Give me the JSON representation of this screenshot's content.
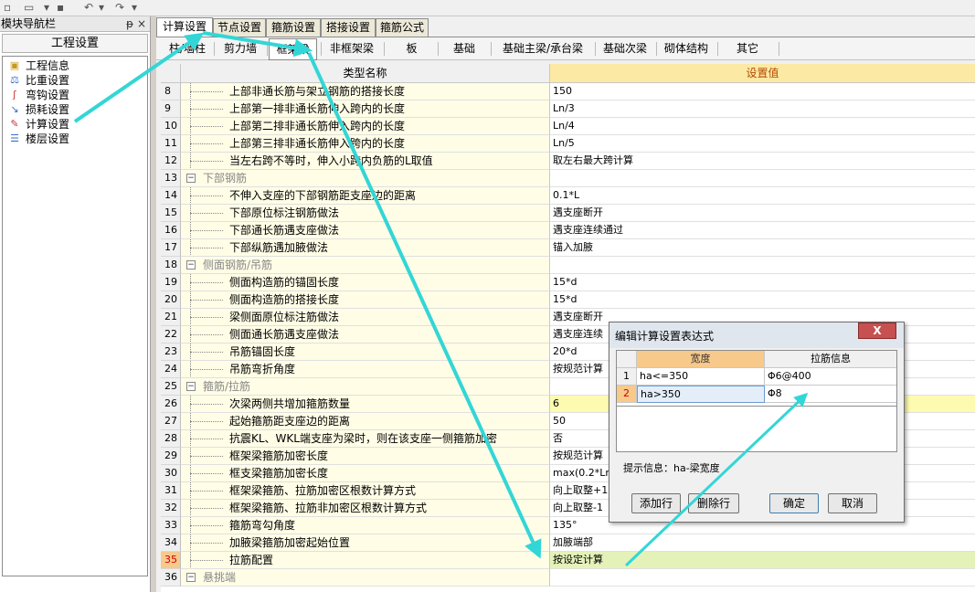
{
  "toolbar": {
    "icons": [
      "new-file-icon",
      "open-folder-icon",
      "save-icon",
      "undo-icon",
      "redo-icon"
    ]
  },
  "nav": {
    "header": "模块导航栏",
    "pin_glyph": "ᵽ",
    "close_glyph": "×",
    "title": "工程设置",
    "items": [
      {
        "label": "工程信息",
        "icon": "project-info-icon"
      },
      {
        "label": "比重设置",
        "icon": "ratio-icon"
      },
      {
        "label": "弯钩设置",
        "icon": "hook-icon"
      },
      {
        "label": "损耗设置",
        "icon": "loss-icon"
      },
      {
        "label": "计算设置",
        "icon": "calc-icon"
      },
      {
        "label": "楼层设置",
        "icon": "floor-icon"
      }
    ]
  },
  "tabs": [
    "计算设置",
    "节点设置",
    "箍筋设置",
    "搭接设置",
    "箍筋公式"
  ],
  "subtabs": [
    "柱/墙柱",
    "剪力墙",
    "框架梁",
    "非框架梁",
    "板",
    "基础",
    "基础主梁/承台梁",
    "基础次梁",
    "砌体结构",
    "其它"
  ],
  "grid": {
    "col_name": "类型名称",
    "col_value": "设置值",
    "rows": [
      {
        "n": "8",
        "type": "item",
        "name": "上部非通长筋与架立钢筋的搭接长度",
        "value": "150"
      },
      {
        "n": "9",
        "type": "item",
        "name": "上部第一排非通长筋伸入跨内的长度",
        "value": "Ln/3"
      },
      {
        "n": "10",
        "type": "item",
        "name": "上部第二排非通长筋伸入跨内的长度",
        "value": "Ln/4"
      },
      {
        "n": "11",
        "type": "item",
        "name": "上部第三排非通长筋伸入跨内的长度",
        "value": "Ln/5"
      },
      {
        "n": "12",
        "type": "item",
        "name": "当左右跨不等时，伸入小跨内负筋的L取值",
        "value": "取左右最大跨计算"
      },
      {
        "n": "13",
        "type": "cat",
        "name": "下部钢筋",
        "value": ""
      },
      {
        "n": "14",
        "type": "item",
        "name": "不伸入支座的下部钢筋距支座边的距离",
        "value": "0.1*L"
      },
      {
        "n": "15",
        "type": "item",
        "name": "下部原位标注钢筋做法",
        "value": "遇支座断开"
      },
      {
        "n": "16",
        "type": "item",
        "name": "下部通长筋遇支座做法",
        "value": "遇支座连续通过"
      },
      {
        "n": "17",
        "type": "item",
        "name": "下部纵筋遇加腋做法",
        "value": "锚入加腋"
      },
      {
        "n": "18",
        "type": "cat",
        "name": "侧面钢筋/吊筋",
        "value": ""
      },
      {
        "n": "19",
        "type": "item",
        "name": "侧面构造筋的锚固长度",
        "value": "15*d"
      },
      {
        "n": "20",
        "type": "item",
        "name": "侧面构造筋的搭接长度",
        "value": "15*d"
      },
      {
        "n": "21",
        "type": "item",
        "name": "梁侧面原位标注筋做法",
        "value": "遇支座断开"
      },
      {
        "n": "22",
        "type": "item",
        "name": "侧面通长筋遇支座做法",
        "value": "遇支座连续"
      },
      {
        "n": "23",
        "type": "item",
        "name": "吊筋锚固长度",
        "value": "20*d"
      },
      {
        "n": "24",
        "type": "item",
        "name": "吊筋弯折角度",
        "value": "按规范计算"
      },
      {
        "n": "25",
        "type": "cat",
        "name": "箍筋/拉筋",
        "value": ""
      },
      {
        "n": "26",
        "type": "item",
        "name": "次梁两侧共增加箍筋数量",
        "value": "6",
        "hl": true
      },
      {
        "n": "27",
        "type": "item",
        "name": "起始箍筋距支座边的距离",
        "value": "50"
      },
      {
        "n": "28",
        "type": "item",
        "name": "抗震KL、WKL端支座为梁时，则在该支座一侧箍筋加密",
        "value": "否"
      },
      {
        "n": "29",
        "type": "item",
        "name": "框架梁箍筋加密长度",
        "value": "按规范计算"
      },
      {
        "n": "30",
        "type": "item",
        "name": "框支梁箍筋加密长度",
        "value": "max(0.2*Ln"
      },
      {
        "n": "31",
        "type": "item",
        "name": "框架梁箍筋、拉筋加密区根数计算方式",
        "value": "向上取整+1"
      },
      {
        "n": "32",
        "type": "item",
        "name": "框架梁箍筋、拉筋非加密区根数计算方式",
        "value": "向上取整-1"
      },
      {
        "n": "33",
        "type": "item",
        "name": "箍筋弯勾角度",
        "value": "135°"
      },
      {
        "n": "34",
        "type": "item",
        "name": "加腋梁箍筋加密起始位置",
        "value": "加腋端部"
      },
      {
        "n": "35",
        "type": "item",
        "name": "拉筋配置",
        "value": "按设定计算",
        "sel": true
      },
      {
        "n": "36",
        "type": "cat",
        "name": "悬挑端",
        "value": ""
      }
    ]
  },
  "dialog": {
    "title": "编辑计算设置表达式",
    "close_glyph": "X",
    "col_width": "宽度",
    "col_info": "拉筋信息",
    "rows": [
      {
        "n": "1",
        "width": "ha<=350",
        "info": "Φ6@400"
      },
      {
        "n": "2",
        "width": "ha>350",
        "info": "Φ8"
      }
    ],
    "hint": "提示信息：ha-梁宽度",
    "buttons": {
      "add": "添加行",
      "delete": "删除行",
      "ok": "确定",
      "cancel": "取消"
    }
  },
  "colors": {
    "selection_orange": "#f7c98b",
    "header_yellow": "#fce9a4",
    "row_yellow": "#fffde6",
    "arrow_cyan": "#33d6d6"
  }
}
